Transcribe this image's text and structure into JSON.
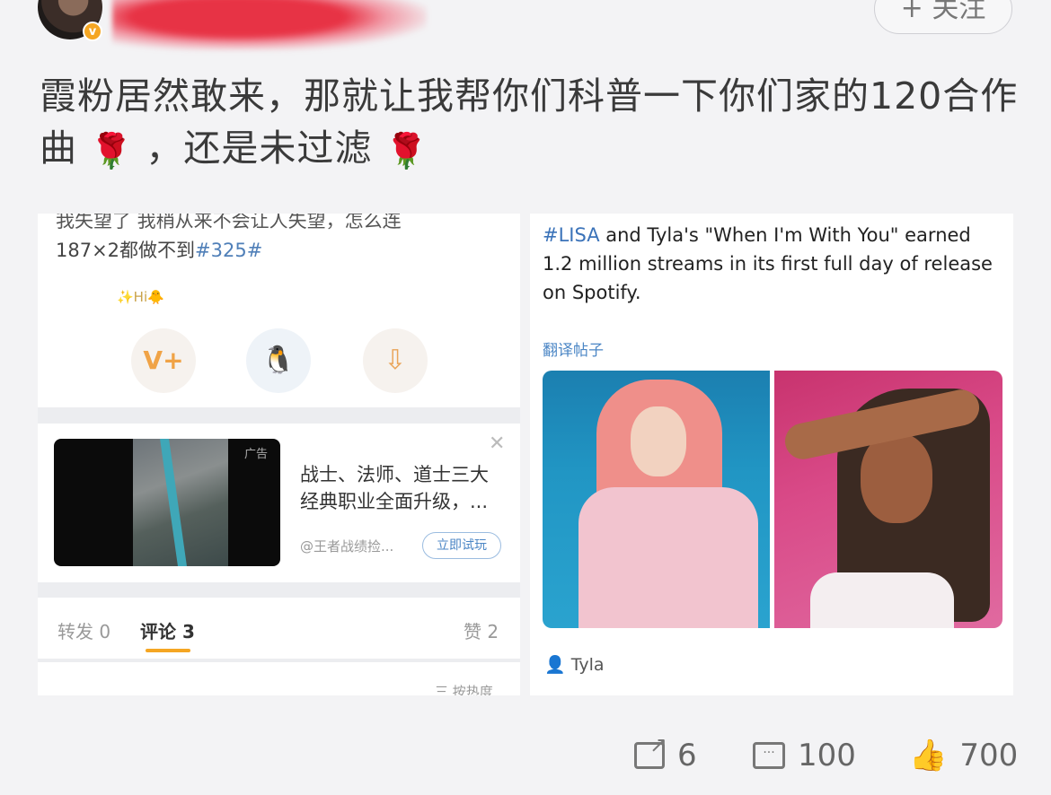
{
  "header": {
    "follow_label": "+ 关注",
    "vip_badge": "v"
  },
  "post": {
    "text_part1": "霞粉居然敢来，那就让我帮你们科普一下你们家的120合作曲",
    "text_part2": "，还是未过滤",
    "emoji": "🌹"
  },
  "left_card": {
    "cut_line": "我失望了 我稍从来不会让人失望，怎么连",
    "line2_text": "187×2都做不到",
    "line2_tag": "#325#",
    "hi_text": "✨Hi🐥",
    "icon1": "V+",
    "icon2": "🐧",
    "icon3": "⇩",
    "ad": {
      "tag": "广告",
      "close": "✕",
      "title": "战士、法师、道士三大经典职业全面升级，...",
      "source": "@王者战绩捡...",
      "button": "立即试玩"
    },
    "tabs": {
      "repost": "转发 0",
      "comment": "评论 3",
      "like": "赞 2"
    },
    "sort": "三 按热度"
  },
  "right_card": {
    "tag": "#LISA",
    "text": " and Tyla's \"When I'm With You\" earned 1.2 million streams in its first full day of release on Spotify.",
    "translate": "翻译帖子",
    "author": "Tyla"
  },
  "footer": {
    "shares": "6",
    "comments": "100",
    "likes": "700"
  },
  "colors": {
    "accent": "#f5a623",
    "link": "#4b86c5"
  }
}
